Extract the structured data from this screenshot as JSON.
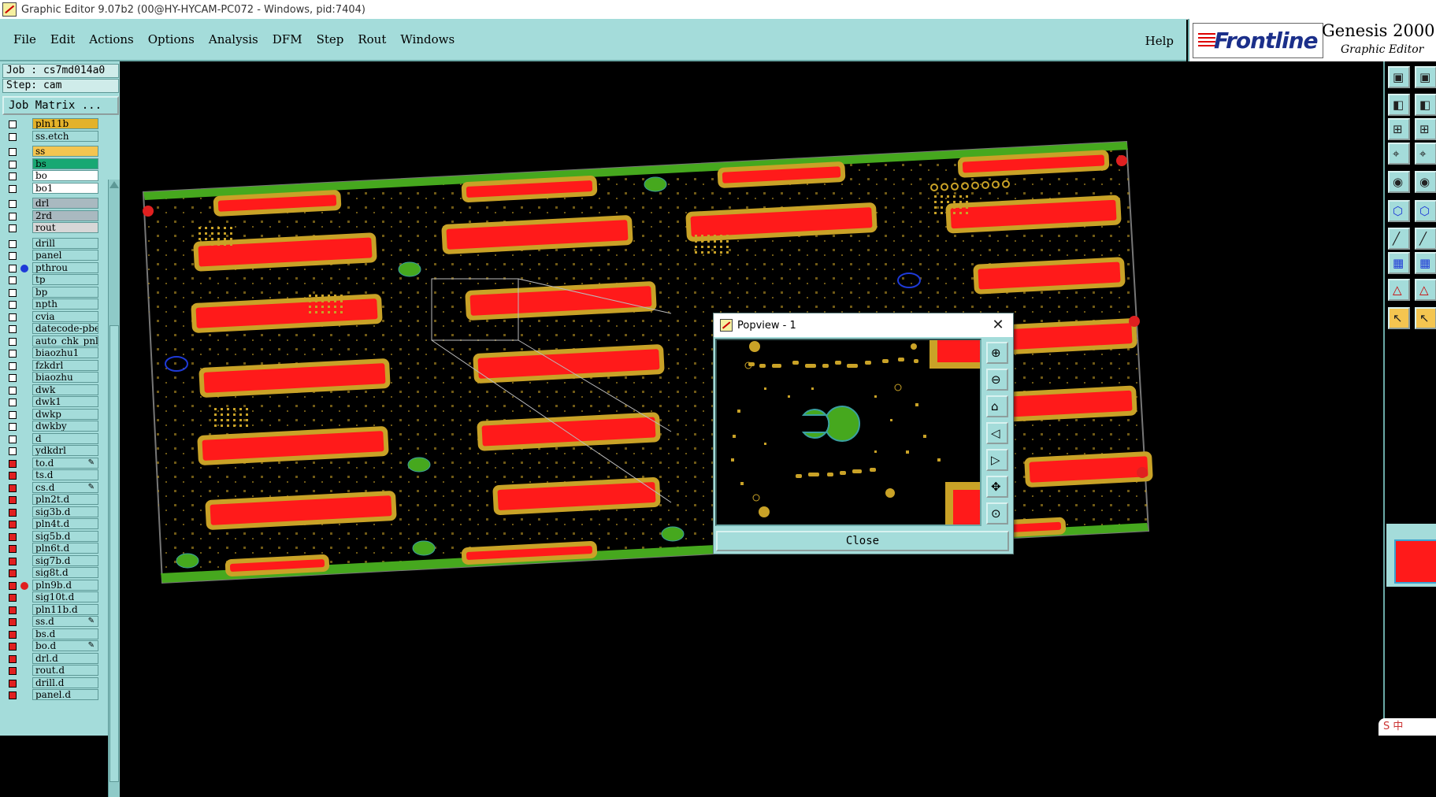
{
  "window": {
    "title": "Graphic Editor 9.07b2 (00@HY-HYCAM-PC072 - Windows, pid:7404)"
  },
  "menu": {
    "items": [
      "File",
      "Edit",
      "Actions",
      "Options",
      "Analysis",
      "DFM",
      "Step",
      "Rout",
      "Windows"
    ],
    "help": "Help"
  },
  "brand": {
    "logo": "Frontline",
    "product": "Genesis 2000 ©",
    "subtitle": "Graphic Editor"
  },
  "job": {
    "job_label": "Job : cs7md014a0",
    "step_label": "Step: cam",
    "matrix_button": "Job Matrix ..."
  },
  "layers": [
    {
      "name": "pln11b",
      "color": "#e3b22a",
      "check": "white"
    },
    {
      "name": "ss.etch",
      "color": "#a4dcda",
      "check": "white"
    },
    {
      "name": "ss",
      "color": "#f4c550",
      "check": "white"
    },
    {
      "name": "bs",
      "color": "#18a873",
      "check": "white"
    },
    {
      "name": "bo",
      "color": "#ffffff",
      "check": "white"
    },
    {
      "name": "bo1",
      "color": "#ffffff",
      "check": "white"
    },
    {
      "name": "drl",
      "color": "#a9b9c0",
      "check": "white"
    },
    {
      "name": "2rd",
      "color": "#a9b9c0",
      "check": "white"
    },
    {
      "name": "rout",
      "color": "#d7d7d7",
      "check": "white"
    },
    {
      "name": "drill",
      "color": "#a4dcda",
      "check": "white"
    },
    {
      "name": "panel",
      "color": "#a4dcda",
      "check": "white"
    },
    {
      "name": "pthrou",
      "color": "#a4dcda",
      "check": "white",
      "dot": "#1e3ad8"
    },
    {
      "name": "tp",
      "color": "#a4dcda",
      "check": "white"
    },
    {
      "name": "bp",
      "color": "#a4dcda",
      "check": "white"
    },
    {
      "name": "npth",
      "color": "#a4dcda",
      "check": "white"
    },
    {
      "name": "cvia",
      "color": "#a4dcda",
      "check": "white"
    },
    {
      "name": "datecode-pbe",
      "color": "#a4dcda",
      "check": "white"
    },
    {
      "name": "auto_chk_pnl",
      "color": "#a4dcda",
      "check": "white"
    },
    {
      "name": "biaozhu1",
      "color": "#a4dcda",
      "check": "white"
    },
    {
      "name": "fzkdrl",
      "color": "#a4dcda",
      "check": "white"
    },
    {
      "name": "biaozhu",
      "color": "#a4dcda",
      "check": "white"
    },
    {
      "name": "dwk",
      "color": "#a4dcda",
      "check": "white"
    },
    {
      "name": "dwk1",
      "color": "#a4dcda",
      "check": "white"
    },
    {
      "name": "dwkp",
      "color": "#a4dcda",
      "check": "white"
    },
    {
      "name": "dwkby",
      "color": "#a4dcda",
      "check": "white"
    },
    {
      "name": "d",
      "color": "#a4dcda",
      "check": "white"
    },
    {
      "name": "ydkdrl",
      "color": "#a4dcda",
      "check": "white"
    },
    {
      "name": "to.d",
      "color": "#a4dcda",
      "check": "red",
      "edit": "true"
    },
    {
      "name": "ts.d",
      "color": "#a4dcda",
      "check": "red"
    },
    {
      "name": "cs.d",
      "color": "#a4dcda",
      "check": "red",
      "edit": "true"
    },
    {
      "name": "pln2t.d",
      "color": "#a4dcda",
      "check": "red"
    },
    {
      "name": "sig3b.d",
      "color": "#a4dcda",
      "check": "red"
    },
    {
      "name": "pln4t.d",
      "color": "#a4dcda",
      "check": "red"
    },
    {
      "name": "sig5b.d",
      "color": "#a4dcda",
      "check": "red"
    },
    {
      "name": "pln6t.d",
      "color": "#a4dcda",
      "check": "red"
    },
    {
      "name": "sig7b.d",
      "color": "#a4dcda",
      "check": "red"
    },
    {
      "name": "sig8t.d",
      "color": "#a4dcda",
      "check": "red"
    },
    {
      "name": "pln9b.d",
      "color": "#a4dcda",
      "check": "red",
      "dot": "#e02020"
    },
    {
      "name": "sig10t.d",
      "color": "#a4dcda",
      "check": "red"
    },
    {
      "name": "pln11b.d",
      "color": "#a4dcda",
      "check": "red"
    },
    {
      "name": "ss.d",
      "color": "#a4dcda",
      "check": "red",
      "edit": "true"
    },
    {
      "name": "bs.d",
      "color": "#a4dcda",
      "check": "red"
    },
    {
      "name": "bo.d",
      "color": "#a4dcda",
      "check": "red",
      "edit": "true"
    },
    {
      "name": "drl.d",
      "color": "#a4dcda",
      "check": "red"
    },
    {
      "name": "rout.d",
      "color": "#a4dcda",
      "check": "red"
    },
    {
      "name": "drill.d",
      "color": "#a4dcda",
      "check": "red"
    },
    {
      "name": "panel.d",
      "color": "#a4dcda",
      "check": "red"
    }
  ],
  "popview": {
    "title": "Popview - 1",
    "close_button": "Close"
  },
  "ime": {
    "label": "S 中"
  },
  "colors": {
    "panel": "#a4dcda",
    "copper": "#c9a227",
    "pad": "#ff1a1a",
    "mask": "#46a81e",
    "background": "#000000"
  }
}
